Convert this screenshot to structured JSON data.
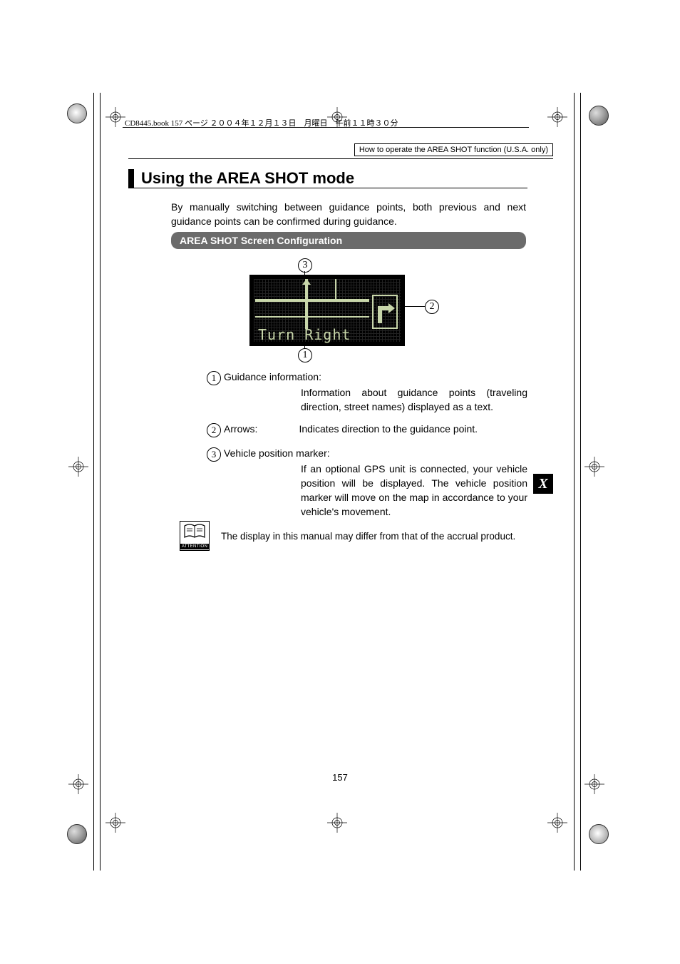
{
  "prepress_header": "CD8445.book  157 ページ  ２００４年１２月１３日　月曜日　午前１１時３０分",
  "section_header": "How to operate the AREA SHOT function (U.S.A. only)",
  "h1": "Using the AREA SHOT mode",
  "intro": "By manually switching between guidance points, both previous and next guidance points can be confirmed during guidance.",
  "subheader": "AREA SHOT Screen Configuration",
  "screen_text": "Turn Right",
  "callouts": {
    "c1": "1",
    "c2": "2",
    "c3": "3"
  },
  "definitions": [
    {
      "num": "1",
      "term": "Guidance information:",
      "desc": "Information about guidance points (traveling direction, street names) displayed as a text."
    },
    {
      "num": "2",
      "term": "Arrows:",
      "desc": "Indicates direction to the guidance point."
    },
    {
      "num": "3",
      "term": "Vehicle position marker:",
      "desc": "If an optional GPS unit is connected, your vehicle position will be displayed. The vehicle position marker will move on the map in accordance to your vehicle's movement."
    }
  ],
  "attention_label": "ATTENTION",
  "attention_text": "The display in this manual may differ from that of the accrual product.",
  "tab": "X",
  "page_number": "157"
}
